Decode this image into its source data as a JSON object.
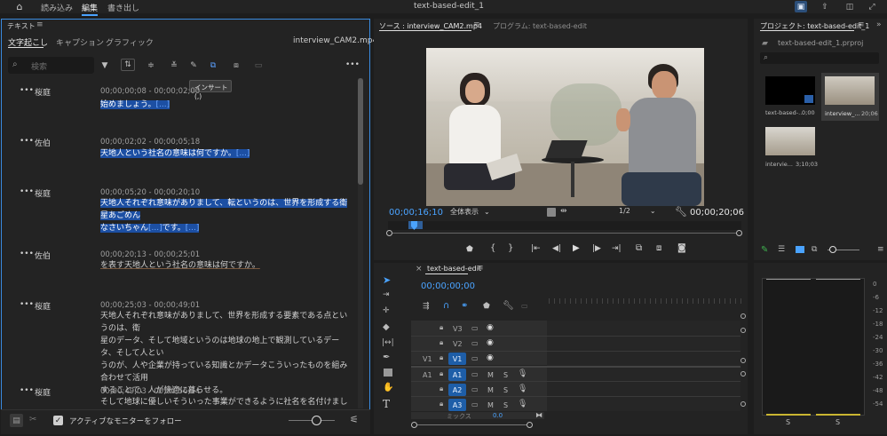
{
  "topbar": {
    "home_icon": "home-icon",
    "tabs": [
      "読み込み",
      "編集",
      "書き出し"
    ],
    "active_tab": "編集",
    "project_title": "text-based-edit_1",
    "right_icons": [
      "quick-export-icon",
      "share-icon",
      "notifications-icon",
      "fullscreen-icon"
    ]
  },
  "text_panel": {
    "title": "テキスト",
    "tabs": [
      "文字起こし",
      "キャプション",
      "グラフィック"
    ],
    "active_tab": "文字起こし",
    "clip_name": "interview_CAM2.mp4",
    "search_placeholder": "検索",
    "tooltip": "インサート (,)",
    "more": "•••",
    "entries": [
      {
        "speaker": "桜庭",
        "timecode": "00;00;00;08 - 00;00;02;00",
        "text": "始めましょう。",
        "link": "[...]",
        "highlighted": true
      },
      {
        "speaker": "佐伯",
        "timecode": "00;00;02;02 - 00;00;05;18",
        "text": "天地人という社名の意味は何ですか。",
        "link": "[...]",
        "highlighted": true
      },
      {
        "speaker": "桜庭",
        "timecode": "00;00;05;20 - 00;00;20;10",
        "text_line1": "天地人それぞれ意味がありまして、転というのは、世界を形成する衛星あごめん",
        "text_line2": "なさいちゃん",
        "link_mid": "[...]",
        "text_line2b": "です。",
        "link": "[...]",
        "highlighted": true
      },
      {
        "speaker": "佐伯",
        "timecode": "00;00;20;13 - 00;00;25;01",
        "text": "を表す天地人という社名の意味は何ですか。",
        "highlighted": false
      },
      {
        "speaker": "桜庭",
        "timecode": "00;00;25;03 - 00;00;49;01",
        "text_line1": "天地人それぞれ意味がありまして、世界を形成する要素である点というのは、衛",
        "text_line2": "星のデータ、そして地域というのは地球の地上で観測しているデータ、そして人とい",
        "text_line3": "うのが、人や企業が持っている知識とかデータこういったものを組み合わせて活用",
        "text_line4": "することで、人が快適に暮らせる。",
        "highlighted": false
      },
      {
        "speaker": "桜庭",
        "timecode": "00;00;49;03 - 00;00;56;14",
        "text": "そして地球に優しいそういった事業ができるように社名を名付けました。",
        "link": "[...]",
        "highlighted": false
      }
    ],
    "footer": {
      "follow_label": "アクティブなモニターをフォロー",
      "follow_checked": true
    }
  },
  "monitor": {
    "source_tab": "ソース : interview_CAM2.mp4",
    "program_tab": "プログラム: text-based-edit",
    "current_time": "00;00;16;10",
    "zoom": "全体表示",
    "resolution": "1/2",
    "duration": "00;00;20;06"
  },
  "project": {
    "title": "プロジェクト: text-based-edit_1",
    "file": "text-based-edit_1.prproj",
    "search_placeholder": "",
    "items": [
      {
        "name": "text-based-...",
        "duration": "0;00"
      },
      {
        "name": "interview_...",
        "duration": "20;06"
      },
      {
        "name": "intervie...",
        "duration": "3;10;03"
      }
    ]
  },
  "timeline": {
    "sequence": "text-based-edit",
    "timecode": "00;00;00;00",
    "video_tracks": [
      "V3",
      "V2",
      "V1"
    ],
    "audio_tracks": [
      "A1",
      "A2",
      "A3"
    ],
    "source_v": "V1",
    "source_a": "A1",
    "mix_label": "ミックス",
    "mix_value": "0.0",
    "m_label": "M",
    "s_label": "S"
  },
  "meter": {
    "db_scale": [
      "0",
      "-6",
      "-12",
      "-18",
      "-24",
      "-30",
      "-36",
      "-42",
      "-48",
      "-54"
    ],
    "bottom_labels": [
      "S",
      "S"
    ]
  },
  "colors": {
    "accent": "#3a8be0",
    "highlight": "#1c4fa3",
    "link": "#6fa8ff",
    "active_track": "#1e5ea8"
  }
}
